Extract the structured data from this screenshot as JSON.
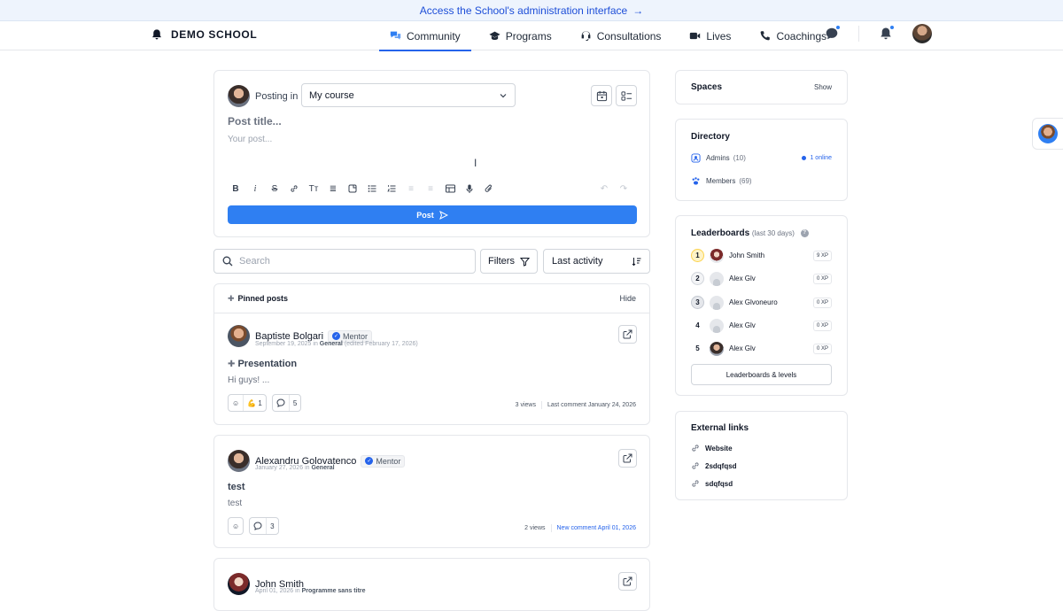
{
  "banner": {
    "text": "Access the School's administration interface",
    "arrow": "→"
  },
  "brand": {
    "name": "DEMO SCHOOL"
  },
  "nav": {
    "items": [
      {
        "label": "Community",
        "icon": "chat-bubbles-icon",
        "active": true
      },
      {
        "label": "Programs",
        "icon": "graduation-cap-icon",
        "active": false
      },
      {
        "label": "Consultations",
        "icon": "headset-icon",
        "active": false
      },
      {
        "label": "Lives",
        "icon": "video-camera-icon",
        "active": false
      },
      {
        "label": "Coachings",
        "icon": "phone-icon",
        "active": false
      }
    ]
  },
  "composer": {
    "posting_in_label": "Posting in",
    "space_selected": "My course",
    "title_placeholder": "Post title...",
    "body_placeholder": "Your post...",
    "post_button": "Post"
  },
  "feed": {
    "search_placeholder": "Search",
    "filters_label": "Filters",
    "sort_label": "Last activity"
  },
  "pinned": {
    "header": "Pinned posts",
    "hide_label": "Hide",
    "post": {
      "author": "Baptiste Bolgari",
      "role": "Mentor",
      "date": "September 19, 2025",
      "in_label": "in",
      "space": "General",
      "edited": "(edited February 17, 2026)",
      "title": "Presentation",
      "excerpt": "Hi guys! ...",
      "reaction_emoji": "💪",
      "reaction_count": "1",
      "comment_count": "5",
      "views": "3 views",
      "last_comment": "Last comment January 24, 2026"
    }
  },
  "posts": [
    {
      "author": "Alexandru Golovatenco",
      "role": "Mentor",
      "date": "January 27, 2026",
      "in_label": "in",
      "space": "General",
      "title": "test",
      "excerpt": "test",
      "comment_count": "3",
      "views": "2 views",
      "last_comment": "New comment April 01, 2026"
    },
    {
      "author": "John Smith",
      "date": "April 01, 2026",
      "in_label": "in",
      "space": "Programme sans titre"
    }
  ],
  "sidebar": {
    "spaces": {
      "title": "Spaces",
      "show_label": "Show"
    },
    "directory": {
      "title": "Directory",
      "admins_label": "Admins",
      "admins_count": "(10)",
      "online": "1 online",
      "members_label": "Members",
      "members_count": "(69)"
    },
    "leaderboard": {
      "title": "Leaderboards",
      "subtitle": "(last 30 days)",
      "help": "?",
      "rows": [
        {
          "rank": "1",
          "name": "John Smith",
          "xp": "9 XP"
        },
        {
          "rank": "2",
          "name": "Alex Glv",
          "xp": "0 XP"
        },
        {
          "rank": "3",
          "name": "Alex Glvoneuro",
          "xp": "0 XP"
        },
        {
          "rank": "4",
          "name": "Alex Glv",
          "xp": "0 XP"
        },
        {
          "rank": "5",
          "name": "Alex Glv",
          "xp": "0 XP"
        }
      ],
      "button": "Leaderboards & levels"
    },
    "links": {
      "title": "External links",
      "items": [
        "Website",
        "2sdqfqsd",
        "sdqfqsd"
      ]
    }
  },
  "colors": {
    "accent": "#2f7ff2",
    "banner_bg": "#eef4fd",
    "link": "#2563eb"
  }
}
